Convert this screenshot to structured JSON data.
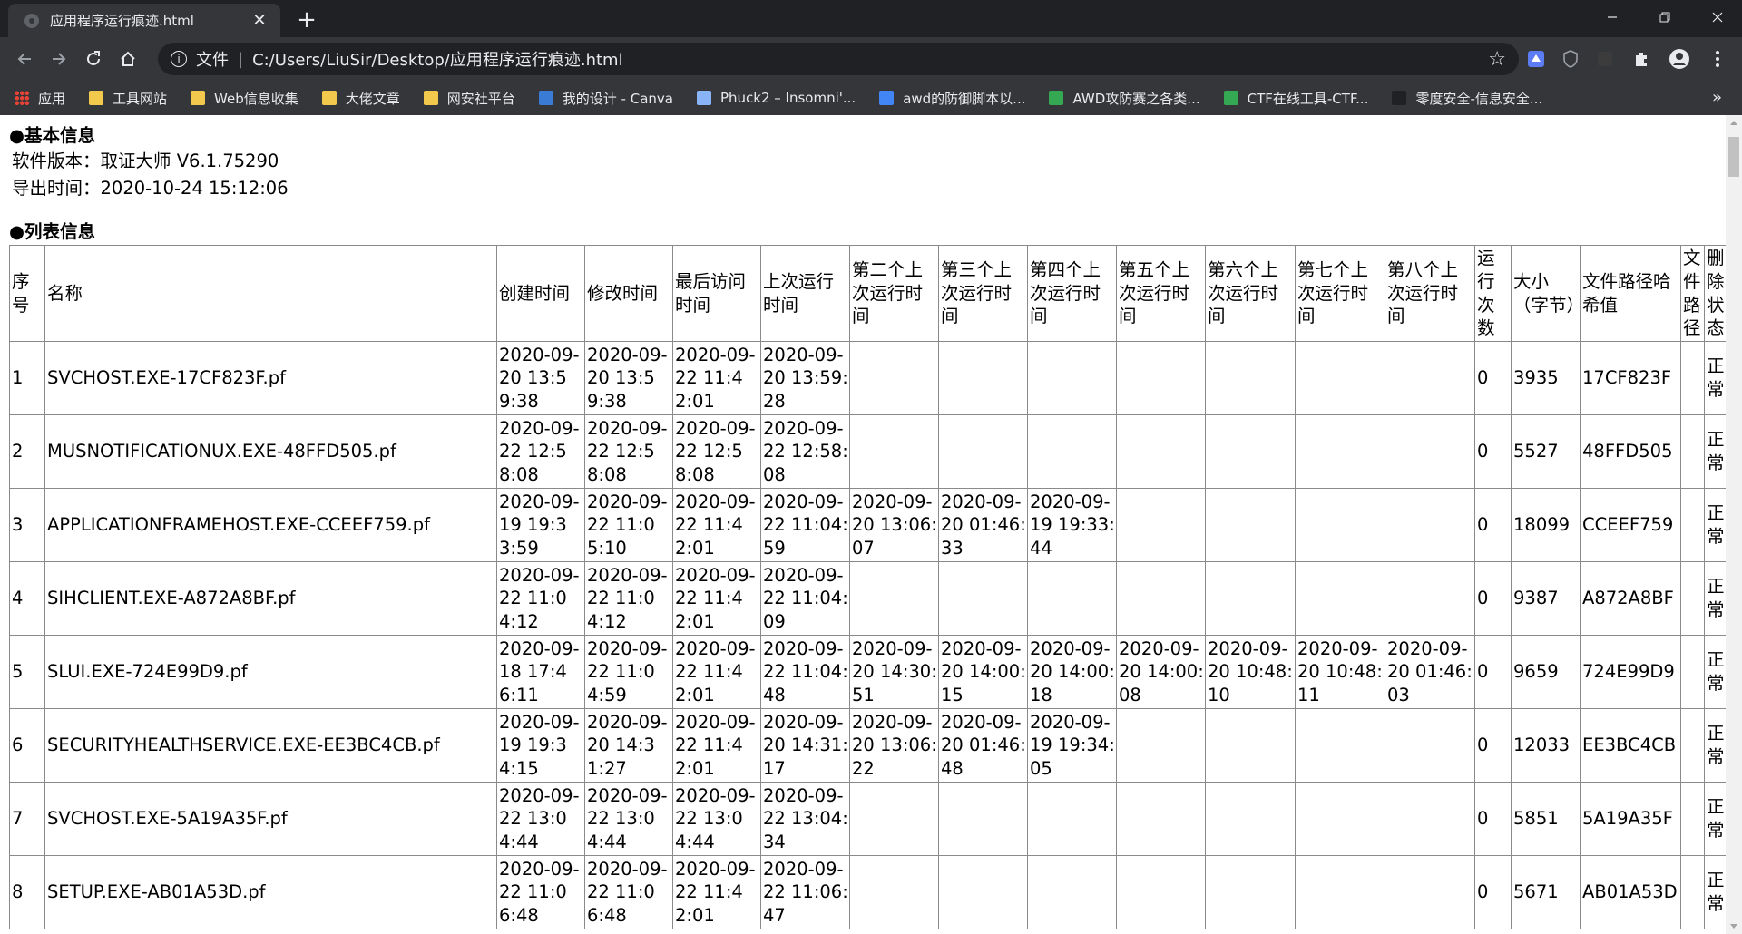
{
  "browser": {
    "tab_title": "应用程序运行痕迹.html",
    "close_glyph": "✕",
    "new_tab_glyph": "+",
    "omnibox": {
      "scheme_label": "文件",
      "url": "C:/Users/LiuSir/Desktop/应用程序运行痕迹.html"
    },
    "bookmarks": [
      {
        "label": "应用",
        "icon": "apps-grid-icon"
      },
      {
        "label": "工具网站",
        "icon": "folder-icon"
      },
      {
        "label": "Web信息收集",
        "icon": "folder-icon"
      },
      {
        "label": "大佬文章",
        "icon": "folder-icon"
      },
      {
        "label": "网安社平台",
        "icon": "folder-icon"
      },
      {
        "label": "我的设计 - Canva",
        "icon": "canva-icon"
      },
      {
        "label": "Phuck2 – Insomni'...",
        "icon": "page-icon"
      },
      {
        "label": "awd的防御脚本以...",
        "icon": "site-icon"
      },
      {
        "label": "AWD攻防赛之各类...",
        "icon": "site-icon"
      },
      {
        "label": "CTF在线工具-CTF...",
        "icon": "site-icon"
      },
      {
        "label": "零度安全-信息安全...",
        "icon": "site-icon"
      }
    ],
    "colors": {
      "tabstrip": "#202124",
      "toolbar": "#35363a",
      "folder": "#f2c94c"
    }
  },
  "page": {
    "basic_title": "●基本信息",
    "software_version": "软件版本：取证大师 V6.1.75290",
    "export_time": "导出时间：2020-10-24 15:12:06",
    "list_title": "●列表信息",
    "table": {
      "headers": [
        "序号",
        "名称",
        "创建时间",
        "修改时间",
        "最后访问时间",
        "上次运行时间",
        "第二个上次运行时间",
        "第三个上次运行时间",
        "第四个上次运行时间",
        "第五个上次运行时间",
        "第六个上次运行时间",
        "第七个上次运行时间",
        "第八个上次运行时间",
        "运行次数",
        "大小（字节）",
        "文件路径哈希值",
        "文件路径",
        "删除状态"
      ],
      "rows": [
        [
          "1",
          "SVCHOST.EXE-17CF823F.pf",
          "2020-09-20 13:59:38",
          "2020-09-20 13:59:38",
          "2020-09-22 11:42:01",
          "2020-09-20 13:59:28",
          "",
          "",
          "",
          "",
          "",
          "",
          "",
          "0",
          "3935",
          "17CF823F",
          "",
          "正常"
        ],
        [
          "2",
          "MUSNOTIFICATIONUX.EXE-48FFD505.pf",
          "2020-09-22 12:58:08",
          "2020-09-22 12:58:08",
          "2020-09-22 12:58:08",
          "2020-09-22 12:58:08",
          "",
          "",
          "",
          "",
          "",
          "",
          "",
          "0",
          "5527",
          "48FFD505",
          "",
          "正常"
        ],
        [
          "3",
          "APPLICATIONFRAMEHOST.EXE-CCEEF759.pf",
          "2020-09-19 19:33:59",
          "2020-09-22 11:05:10",
          "2020-09-22 11:42:01",
          "2020-09-22 11:04:59",
          "2020-09-20 13:06:07",
          "2020-09-20 01:46:33",
          "2020-09-19 19:33:44",
          "",
          "",
          "",
          "",
          "0",
          "18099",
          "CCEEF759",
          "",
          "正常"
        ],
        [
          "4",
          "SIHCLIENT.EXE-A872A8BF.pf",
          "2020-09-22 11:04:12",
          "2020-09-22 11:04:12",
          "2020-09-22 11:42:01",
          "2020-09-22 11:04:09",
          "",
          "",
          "",
          "",
          "",
          "",
          "",
          "0",
          "9387",
          "A872A8BF",
          "",
          "正常"
        ],
        [
          "5",
          "SLUI.EXE-724E99D9.pf",
          "2020-09-18 17:46:11",
          "2020-09-22 11:04:59",
          "2020-09-22 11:42:01",
          "2020-09-22 11:04:48",
          "2020-09-20 14:30:51",
          "2020-09-20 14:00:15",
          "2020-09-20 14:00:18",
          "2020-09-20 14:00:08",
          "2020-09-20 10:48:10",
          "2020-09-20 10:48:11",
          "2020-09-20 01:46:03",
          "0",
          "9659",
          "724E99D9",
          "",
          "正常"
        ],
        [
          "6",
          "SECURITYHEALTHSERVICE.EXE-EE3BC4CB.pf",
          "2020-09-19 19:34:15",
          "2020-09-20 14:31:27",
          "2020-09-22 11:42:01",
          "2020-09-20 14:31:17",
          "2020-09-20 13:06:22",
          "2020-09-20 01:46:48",
          "2020-09-19 19:34:05",
          "",
          "",
          "",
          "",
          "0",
          "12033",
          "EE3BC4CB",
          "",
          "正常"
        ],
        [
          "7",
          "SVCHOST.EXE-5A19A35F.pf",
          "2020-09-22 13:04:44",
          "2020-09-22 13:04:44",
          "2020-09-22 13:04:44",
          "2020-09-22 13:04:34",
          "",
          "",
          "",
          "",
          "",
          "",
          "",
          "0",
          "5851",
          "5A19A35F",
          "",
          "正常"
        ],
        [
          "8",
          "SETUP.EXE-AB01A53D.pf",
          "2020-09-22 11:06:48",
          "2020-09-22 11:06:48",
          "2020-09-22 11:42:01",
          "2020-09-22 11:06:47",
          "",
          "",
          "",
          "",
          "",
          "",
          "",
          "0",
          "5671",
          "AB01A53D",
          "",
          "正常"
        ]
      ]
    }
  }
}
